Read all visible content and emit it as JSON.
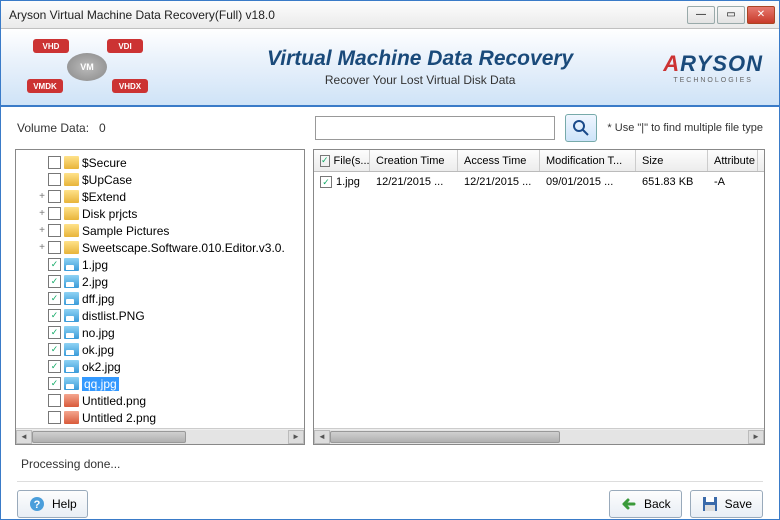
{
  "window": {
    "title": "Aryson Virtual Machine Data Recovery(Full) v18.0"
  },
  "banner": {
    "heading": "Virtual Machine Data Recovery",
    "subheading": "Recover Your Lost Virtual Disk Data",
    "formats": {
      "vhd": "VHD",
      "vdi": "VDI",
      "vmdk": "VMDK",
      "vhdx": "VHDX",
      "center": "VM"
    },
    "brand": {
      "name": "RYSON",
      "tag": "TECHNOLOGIES"
    }
  },
  "search": {
    "volume_label": "Volume Data:",
    "volume_value": "0",
    "placeholder": "",
    "hint": "* Use \"|\" to find multiple file type"
  },
  "tree": [
    {
      "indent": 1,
      "check": false,
      "icon": "folder",
      "label": "$Secure",
      "expander": ""
    },
    {
      "indent": 1,
      "check": false,
      "icon": "folder",
      "label": "$UpCase",
      "expander": ""
    },
    {
      "indent": 1,
      "check": false,
      "icon": "folder",
      "label": "$Extend",
      "expander": "+"
    },
    {
      "indent": 1,
      "check": false,
      "icon": "folder",
      "label": "Disk prjcts",
      "expander": "+"
    },
    {
      "indent": 1,
      "check": false,
      "icon": "folder",
      "label": "Sample Pictures",
      "expander": "+"
    },
    {
      "indent": 1,
      "check": false,
      "icon": "folder",
      "label": "Sweetscape.Software.010.Editor.v3.0.",
      "expander": "+"
    },
    {
      "indent": 1,
      "check": true,
      "icon": "img",
      "label": "1.jpg",
      "expander": ""
    },
    {
      "indent": 1,
      "check": true,
      "icon": "img",
      "label": "2.jpg",
      "expander": ""
    },
    {
      "indent": 1,
      "check": true,
      "icon": "img",
      "label": "dff.jpg",
      "expander": ""
    },
    {
      "indent": 1,
      "check": true,
      "icon": "img",
      "label": "distlist.PNG",
      "expander": ""
    },
    {
      "indent": 1,
      "check": true,
      "icon": "img",
      "label": "no.jpg",
      "expander": ""
    },
    {
      "indent": 1,
      "check": true,
      "icon": "img",
      "label": "ok.jpg",
      "expander": ""
    },
    {
      "indent": 1,
      "check": true,
      "icon": "img",
      "label": "ok2.jpg",
      "expander": ""
    },
    {
      "indent": 1,
      "check": true,
      "icon": "img",
      "label": "qq.jpg",
      "expander": "",
      "selected": true
    },
    {
      "indent": 1,
      "check": false,
      "icon": "red",
      "label": "Untitled.png",
      "expander": ""
    },
    {
      "indent": 1,
      "check": false,
      "icon": "red",
      "label": "Untitled  2.png",
      "expander": ""
    }
  ],
  "grid": {
    "columns": [
      "File(s...",
      "Creation Time",
      "Access Time",
      "Modification T...",
      "Size",
      "Attribute"
    ],
    "rows": [
      {
        "check": true,
        "file": "1.jpg",
        "ctime": "12/21/2015 ...",
        "atime": "12/21/2015 ...",
        "mtime": "09/01/2015 ...",
        "size": "651.83 KB",
        "attr": "-A"
      }
    ]
  },
  "status": "Processing done...",
  "buttons": {
    "help": "Help",
    "back": "Back",
    "save": "Save"
  }
}
